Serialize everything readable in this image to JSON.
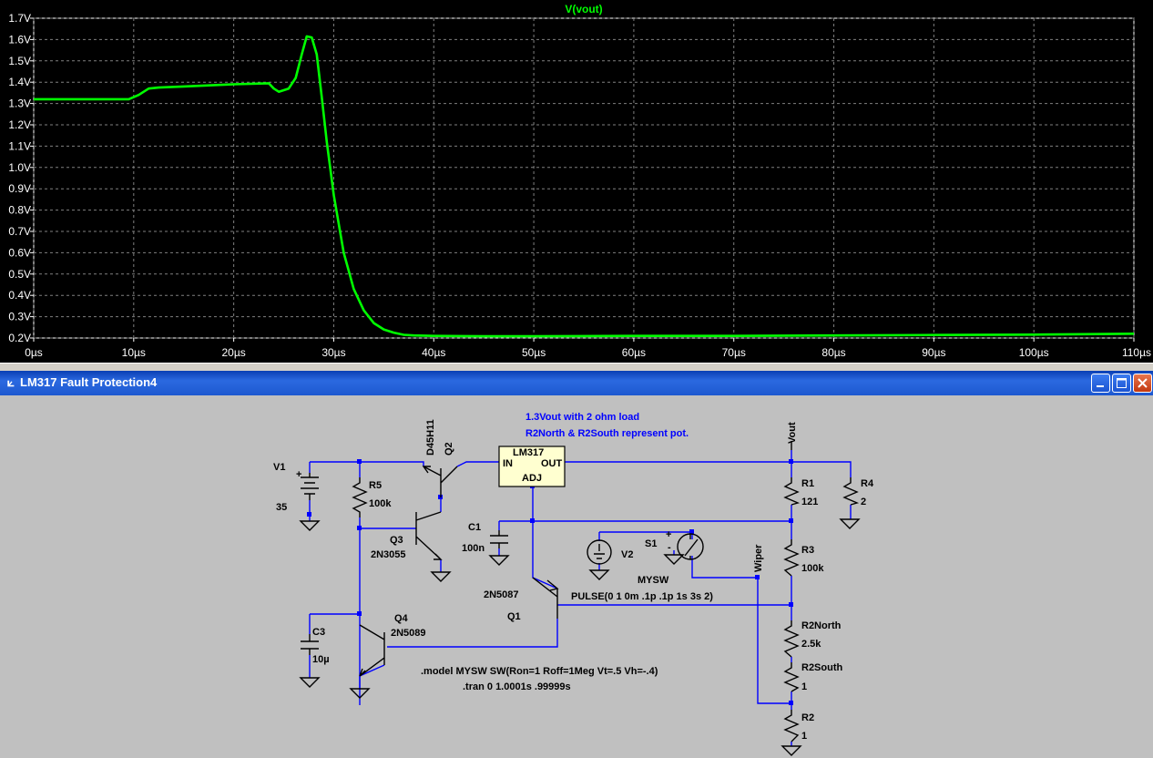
{
  "plot": {
    "trace_name": "V(vout)",
    "trace_color": "#00ff00",
    "background": "#000000",
    "y_tick_labels": [
      "0.2V",
      "0.3V",
      "0.4V",
      "0.5V",
      "0.6V",
      "0.7V",
      "0.8V",
      "0.9V",
      "1.0V",
      "1.1V",
      "1.2V",
      "1.3V",
      "1.4V",
      "1.5V",
      "1.6V",
      "1.7V"
    ],
    "x_tick_labels": [
      "0µs",
      "10µs",
      "20µs",
      "30µs",
      "40µs",
      "50µs",
      "60µs",
      "70µs",
      "80µs",
      "90µs",
      "100µs",
      "110µs"
    ]
  },
  "chart_data": {
    "type": "line",
    "title": "V(vout)",
    "xlabel": "",
    "ylabel": "",
    "xlim": [
      0,
      110
    ],
    "ylim": [
      0.2,
      1.7
    ],
    "x_unit": "µs",
    "y_unit": "V",
    "grid": true,
    "series": [
      {
        "name": "V(vout)",
        "color": "#00ff00",
        "x": [
          0,
          5,
          9.5,
          10.5,
          11.5,
          12.5,
          15,
          20,
          23.5,
          24,
          24.5,
          25.5,
          26.2,
          26.8,
          27.3,
          27.8,
          28.3,
          28.8,
          29.3,
          30,
          31,
          32,
          33,
          34,
          35,
          36,
          37,
          38,
          40,
          45,
          50,
          60,
          70,
          80,
          90,
          100,
          105,
          110
        ],
        "y": [
          1.32,
          1.32,
          1.32,
          1.34,
          1.37,
          1.375,
          1.38,
          1.39,
          1.395,
          1.37,
          1.355,
          1.37,
          1.42,
          1.53,
          1.615,
          1.61,
          1.53,
          1.33,
          1.12,
          0.87,
          0.6,
          0.43,
          0.33,
          0.27,
          0.24,
          0.225,
          0.215,
          0.212,
          0.21,
          0.208,
          0.208,
          0.21,
          0.21,
          0.212,
          0.214,
          0.216,
          0.218,
          0.22
        ]
      }
    ]
  },
  "window": {
    "title": "LM317 Fault Protection4",
    "icon": "ltspice-icon",
    "minimize_icon": "minimize-icon",
    "maximize_icon": "maximize-icon",
    "close_icon": "close-icon"
  },
  "schematic": {
    "notes": {
      "line1": "1.3Vout with 2 ohm load",
      "line2": "R2North & R2South represent pot.",
      "model": ".model MYSW SW(Ron=1 Roff=1Meg Vt=.5 Vh=-.4)",
      "tran": ".tran 0 1.0001s .99999s"
    },
    "v1": {
      "name": "V1",
      "value": "35"
    },
    "v2": {
      "name": "V2",
      "value": "PULSE(0 1 0m .1p .1p 1s 3s 2)"
    },
    "s1": {
      "name": "S1",
      "model": "MYSW"
    },
    "r1": {
      "name": "R1",
      "value": "121"
    },
    "r2": {
      "name": "R2",
      "value": "1"
    },
    "r3": {
      "name": "R3",
      "value": "100k"
    },
    "r4": {
      "name": "R4",
      "value": "2"
    },
    "r5": {
      "name": "R5",
      "value": "100k"
    },
    "r2north": {
      "name": "R2North",
      "value": "2.5k"
    },
    "r2south": {
      "name": "R2South",
      "value": "1"
    },
    "c1": {
      "name": "C1",
      "value": "100n"
    },
    "c3": {
      "name": "C3",
      "value": "10µ"
    },
    "q1": {
      "name": "Q1",
      "model": "2N5087"
    },
    "q2": {
      "name": "Q2",
      "model": "D45H11"
    },
    "q3": {
      "name": "Q3",
      "model": "2N3055"
    },
    "q4": {
      "name": "Q4",
      "model": "2N5089"
    },
    "lm317": {
      "name": "LM317",
      "pin_in": "IN",
      "pin_out": "OUT",
      "pin_adj": "ADJ"
    },
    "net_vout": "Vout",
    "net_wiper": "Wiper",
    "plus_sign": "+",
    "minus_sign": "-"
  }
}
